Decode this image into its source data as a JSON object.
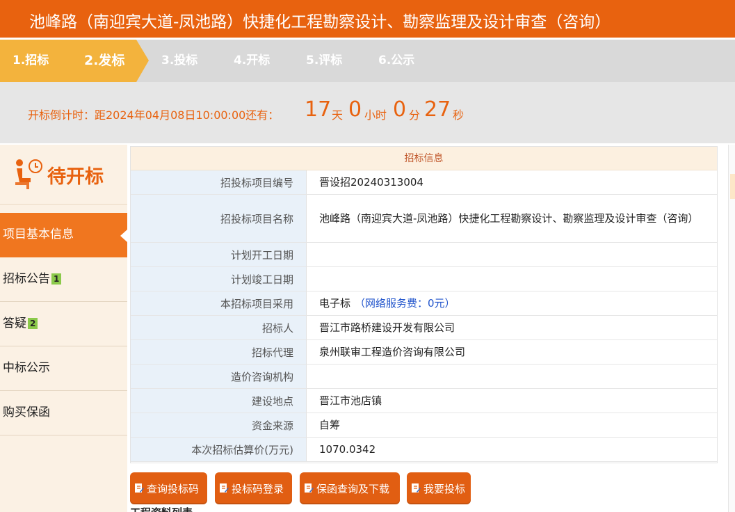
{
  "header": {
    "title": "池峰路（南迎宾大道-凤池路）快捷化工程勘察设计、勘察监理及设计审查（咨询）"
  },
  "steps": [
    {
      "label": "1.招标",
      "state": "done"
    },
    {
      "label": "2.发标",
      "state": "current"
    },
    {
      "label": "3.投标",
      "state": "pending"
    },
    {
      "label": "4.开标",
      "state": "pending"
    },
    {
      "label": "5.评标",
      "state": "pending"
    },
    {
      "label": "6.公示",
      "state": "pending"
    }
  ],
  "countdown": {
    "label": "开标倒计时：距2024年04月08日10:00:00还有：",
    "days": "17",
    "days_unit": "天",
    "hours": "0",
    "hours_unit": "小时",
    "minutes": "0",
    "minutes_unit": "分",
    "seconds": "27",
    "seconds_unit": "秒"
  },
  "sidebar": {
    "status": "待开标",
    "items": [
      {
        "label": "项目基本信息",
        "badge": ""
      },
      {
        "label": "招标公告",
        "badge": "1"
      },
      {
        "label": "答疑",
        "badge": "2"
      },
      {
        "label": "中标公示",
        "badge": ""
      },
      {
        "label": "购买保函",
        "badge": ""
      }
    ]
  },
  "info": {
    "heading": "招标信息",
    "rows": [
      {
        "label": "招投标项目编号",
        "value": "晋设招20240313004"
      },
      {
        "label": "招投标项目名称",
        "value": "池峰路（南迎宾大道-凤池路）快捷化工程勘察设计、勘察监理及设计审查（咨询）"
      },
      {
        "label": "计划开工日期",
        "value": ""
      },
      {
        "label": "计划竣工日期",
        "value": ""
      },
      {
        "label": "本招标项目采用",
        "value": "电子标",
        "note": "（网络服务费：0元）"
      },
      {
        "label": "招标人",
        "value": "晋江市路桥建设开发有限公司"
      },
      {
        "label": "招标代理",
        "value": "泉州联审工程造价咨询有限公司"
      },
      {
        "label": "造价咨询机构",
        "value": ""
      },
      {
        "label": "建设地点",
        "value": "晋江市池店镇"
      },
      {
        "label": "资金来源",
        "value": "自筹"
      },
      {
        "label": "本次招标估算价(万元)",
        "value": "1070.0342"
      }
    ]
  },
  "buttons": [
    {
      "label": "查询投标码"
    },
    {
      "label": "投标码登录"
    },
    {
      "label": "保函查询及下载"
    },
    {
      "label": "我要投标"
    }
  ],
  "footer_text": "工程资料列表",
  "colors": {
    "primary": "#e8620f",
    "step_active": "#f3b33d",
    "badge": "#8bc94a",
    "link": "#2255cc"
  }
}
